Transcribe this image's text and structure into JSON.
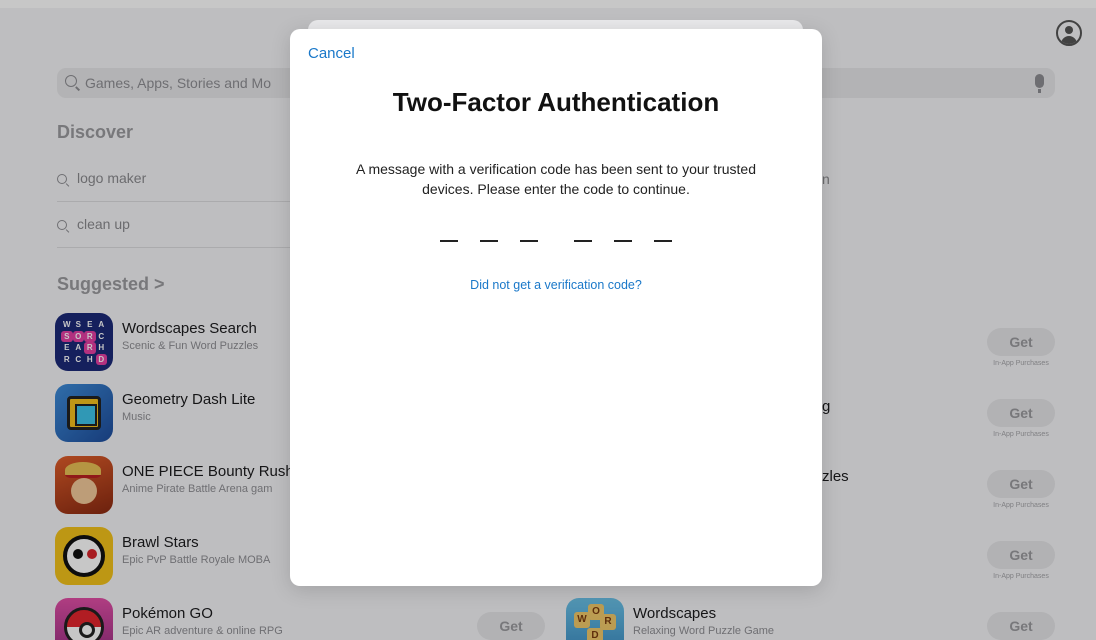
{
  "search": {
    "placeholder": "Games, Apps, Stories and Mo"
  },
  "discover": {
    "title": "Discover",
    "items": [
      "logo maker",
      "clean up"
    ]
  },
  "suggested": {
    "title": "Suggested >"
  },
  "apps_left": [
    {
      "name": "Wordscapes Search",
      "subtitle": "Scenic & Fun Word Puzzles",
      "icon": "wordscapes-search-app-icon"
    },
    {
      "name": "Geometry Dash Lite",
      "subtitle": "Music",
      "icon": "geometry-dash-app-icon"
    },
    {
      "name": "ONE PIECE Bounty Rush",
      "subtitle": "Anime Pirate Battle Arena gam",
      "icon": "one-piece-app-icon"
    },
    {
      "name": "Brawl Stars",
      "subtitle": "Epic PvP Battle Royale MOBA",
      "icon": "brawl-stars-app-icon"
    },
    {
      "name": "Pokémon GO",
      "subtitle": "Epic AR adventure & online RPG",
      "icon": "pokemon-go-app-icon"
    }
  ],
  "apps_right": [
    {
      "name": "Wordscapes",
      "subtitle": "Relaxing Word Puzzle Game",
      "icon": "wordscapes-app-icon"
    }
  ],
  "right_fragments": [
    "n",
    "g",
    "zles"
  ],
  "icon_letters": {
    "wordscapes_search": [
      "W",
      "S",
      "E",
      "A",
      "S",
      "O",
      "R",
      "C",
      "E",
      "A",
      "R",
      "H",
      "R",
      "C",
      "H",
      "D"
    ],
    "wordscapes": [
      "W",
      "O",
      "R",
      "D"
    ]
  },
  "buttons": {
    "get": "Get",
    "iap": "In-App Purchases"
  },
  "modal": {
    "cancel": "Cancel",
    "title": "Two-Factor Authentication",
    "message": "A message with a verification code has been sent to your trusted devices. Please enter the code to continue.",
    "code_length": 6,
    "help_link": "Did not get a verification code?"
  },
  "colors": {
    "link": "#1a78c9",
    "title": "#111111"
  }
}
